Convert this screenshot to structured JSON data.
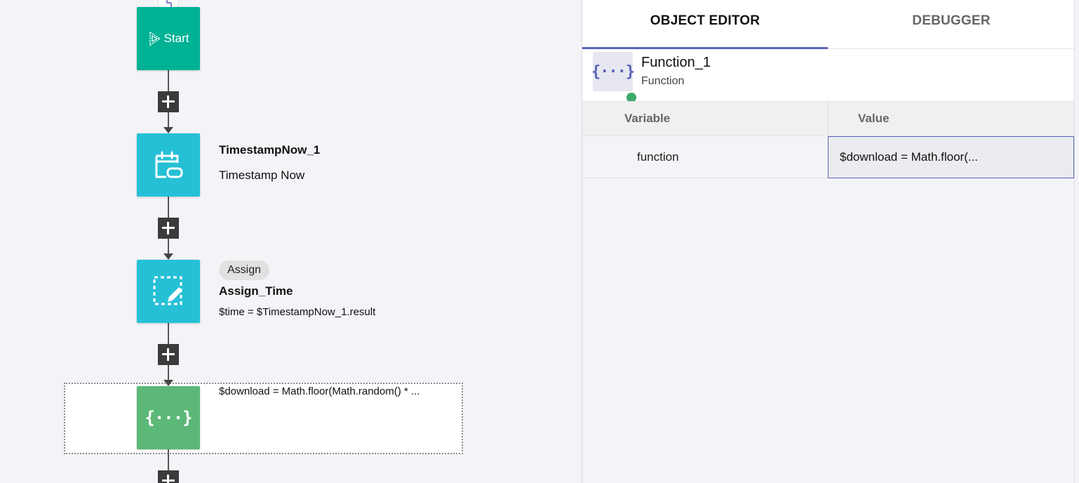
{
  "canvas": {
    "start_node": {
      "label": "Start"
    },
    "nodes": [
      {
        "title": "TimestampNow_1",
        "subtitle": "Timestamp Now"
      },
      {
        "badge": "Assign",
        "title": "Assign_Time",
        "expression": "$time = $TimestampNow_1.result"
      },
      {
        "expression": "$download = Math.floor(Math.random() * ...",
        "icon": "{···}"
      }
    ]
  },
  "panel": {
    "tabs": [
      {
        "label": "OBJECT EDITOR",
        "active": true
      },
      {
        "label": "DEBUGGER",
        "active": false
      }
    ],
    "object": {
      "name": "Function_1",
      "type": "Function",
      "icon": "{···}",
      "status_color": "#3daa6a"
    },
    "grid": {
      "headers": [
        "Variable",
        "Value"
      ],
      "rows": [
        {
          "variable": "function",
          "value": "$download = Math.floor(..."
        }
      ]
    }
  },
  "colors": {
    "start": "#00b294",
    "timestamp": "#25c0d6",
    "assign": "#25c0d6",
    "function": "#5cb878",
    "accent": "#5b63b7"
  }
}
